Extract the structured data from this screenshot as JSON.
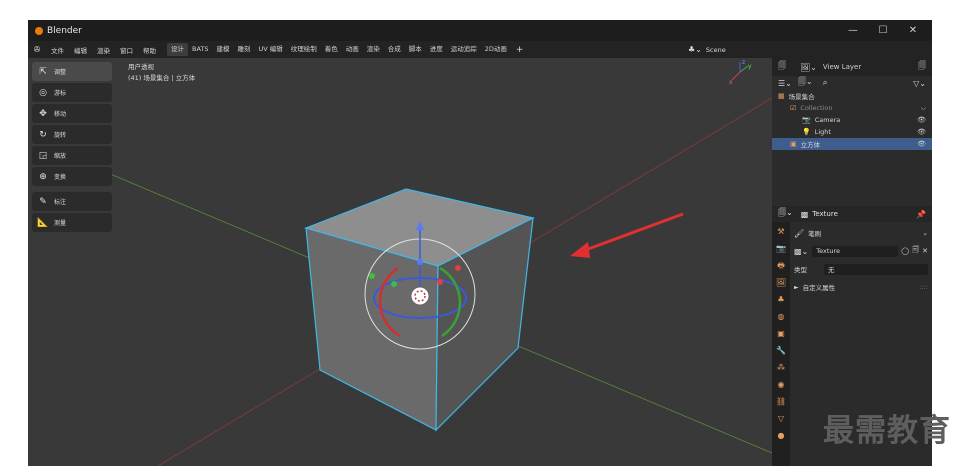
{
  "app": {
    "title": "Blender"
  },
  "window_controls": {
    "minimize": "—",
    "maximize": "☐",
    "close": "✕"
  },
  "menu": {
    "items": [
      "文件",
      "编辑",
      "渲染",
      "窗口",
      "帮助"
    ]
  },
  "workspaces": [
    {
      "label": "设计",
      "active": true
    },
    {
      "label": "BATS",
      "active": false
    },
    {
      "label": "建模",
      "active": false
    },
    {
      "label": "雕刻",
      "active": false
    },
    {
      "label": "UV 编辑",
      "active": false
    },
    {
      "label": "纹理绘制",
      "active": false
    },
    {
      "label": "着色",
      "active": false
    },
    {
      "label": "动画",
      "active": false
    },
    {
      "label": "渲染",
      "active": false
    },
    {
      "label": "合成",
      "active": false
    },
    {
      "label": "脚本",
      "active": false
    },
    {
      "label": "进度",
      "active": false
    },
    {
      "label": "运动追踪",
      "active": false
    },
    {
      "label": "2D动画",
      "active": false
    }
  ],
  "add_workspace": "+",
  "scene": {
    "label": "Scene"
  },
  "view_layer": {
    "label": "View Layer"
  },
  "viewport": {
    "view_name": "用户透视",
    "context": "(41) 场景集合 | 立方体",
    "gizmo_axes": {
      "x": "x",
      "y": "y",
      "z": "z"
    }
  },
  "tools": [
    {
      "label": "调整",
      "icon": "select-cursor-icon",
      "glyph": "⇱",
      "active": true
    },
    {
      "label": "游标",
      "icon": "cursor-icon",
      "glyph": "◎",
      "active": false
    },
    {
      "label": "移动",
      "icon": "move-icon",
      "glyph": "✥",
      "active": false
    },
    {
      "label": "旋转",
      "icon": "rotate-icon",
      "glyph": "↻",
      "active": false
    },
    {
      "label": "缩放",
      "icon": "scale-icon",
      "glyph": "◲",
      "active": false
    },
    {
      "label": "变换",
      "icon": "transform-icon",
      "glyph": "⊕",
      "active": false
    },
    {
      "label": "标注",
      "icon": "annotate-icon",
      "glyph": "✎",
      "active": false
    },
    {
      "label": "测量",
      "icon": "measure-icon",
      "glyph": "📐",
      "active": false
    }
  ],
  "outliner": {
    "search_icon": "⌕",
    "rows": [
      {
        "label": "场景集合",
        "indent": 0,
        "selected": false,
        "icon": "▦",
        "eye": ""
      },
      {
        "label": "Collection",
        "indent": 1,
        "selected": false,
        "icon": "☑",
        "eye": "⌵",
        "dim": true
      },
      {
        "label": "Camera",
        "indent": 2,
        "selected": false,
        "icon": "📷",
        "eye": "👁"
      },
      {
        "label": "Light",
        "indent": 2,
        "selected": false,
        "icon": "💡",
        "eye": "👁"
      },
      {
        "label": "立方体",
        "indent": 1,
        "selected": true,
        "icon": "▣",
        "eye": "👁"
      }
    ]
  },
  "properties": {
    "header": "Texture",
    "brush_label": "笔刷",
    "texture_name": "Texture",
    "type_label": "类型",
    "type_value": "无",
    "custom_props": "自定义属性"
  },
  "watermark": "最需教育",
  "colors": {
    "accent_orange": "#e87d0d",
    "selection_blue": "#3f5d8c",
    "annotation_arrow": "#e03030",
    "outline_cyan": "#3fb8e8"
  }
}
